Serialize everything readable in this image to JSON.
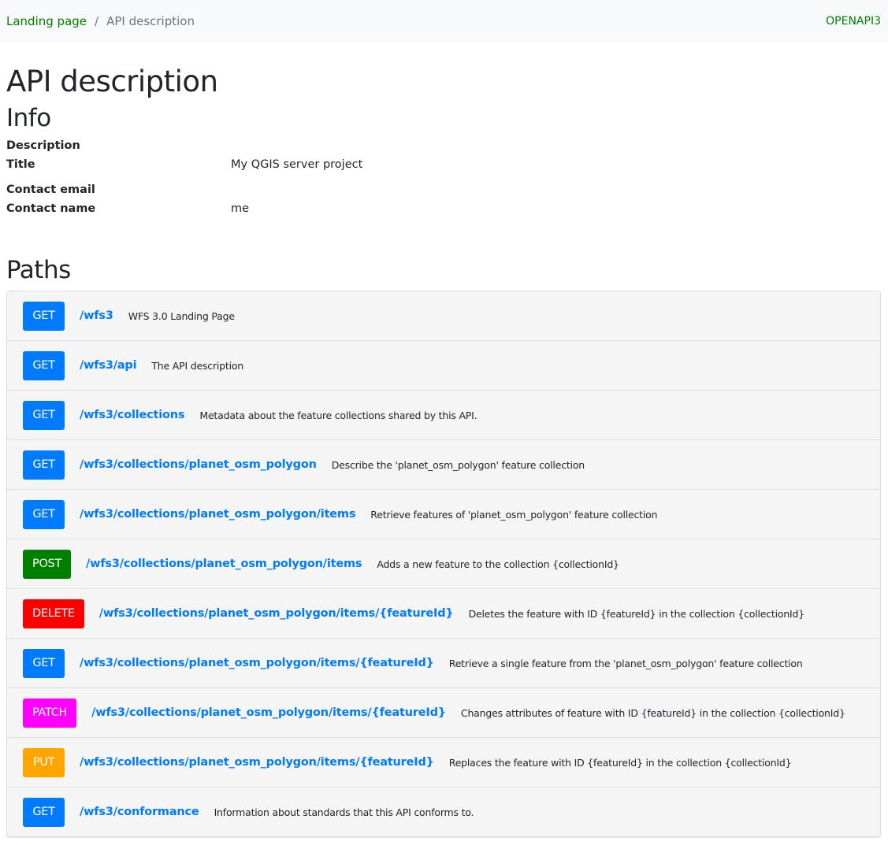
{
  "breadcrumb": {
    "items": [
      {
        "label": "Landing page",
        "link": true
      },
      {
        "label": "API description",
        "link": false
      }
    ],
    "separator": "/"
  },
  "topbar": {
    "format_link": "OPENAPI3"
  },
  "page": {
    "title": "API description"
  },
  "info": {
    "heading": "Info",
    "rows": [
      {
        "key": "Description",
        "value": ""
      },
      {
        "key": "Title",
        "value": "My QGIS server project"
      },
      {
        "key": "Contact email",
        "value": ""
      },
      {
        "key": "Contact name",
        "value": "me"
      }
    ]
  },
  "paths": {
    "heading": "Paths",
    "method_colors": {
      "GET": "#007bff",
      "POST": "#008000",
      "DELETE": "#ff0000",
      "PATCH": "#ff00ff",
      "PUT": "#ffa500"
    },
    "items": [
      {
        "method": "GET",
        "path": "/wfs3",
        "summary": "WFS 3.0 Landing Page"
      },
      {
        "method": "GET",
        "path": "/wfs3/api",
        "summary": "The API description"
      },
      {
        "method": "GET",
        "path": "/wfs3/collections",
        "summary": "Metadata about the feature collections shared by this API."
      },
      {
        "method": "GET",
        "path": "/wfs3/collections/planet_osm_polygon",
        "summary": "Describe the 'planet_osm_polygon' feature collection"
      },
      {
        "method": "GET",
        "path": "/wfs3/collections/planet_osm_polygon/items",
        "summary": "Retrieve features of 'planet_osm_polygon' feature collection"
      },
      {
        "method": "POST",
        "path": "/wfs3/collections/planet_osm_polygon/items",
        "summary": "Adds a new feature to the collection {collectionId}"
      },
      {
        "method": "DELETE",
        "path": "/wfs3/collections/planet_osm_polygon/items/{featureId}",
        "summary": "Deletes the feature with ID {featureId} in the collection {collectionId}"
      },
      {
        "method": "GET",
        "path": "/wfs3/collections/planet_osm_polygon/items/{featureId}",
        "summary": "Retrieve a single feature from the 'planet_osm_polygon' feature collection"
      },
      {
        "method": "PATCH",
        "path": "/wfs3/collections/planet_osm_polygon/items/{featureId}",
        "summary": "Changes attributes of feature with ID {featureId} in the collection {collectionId}"
      },
      {
        "method": "PUT",
        "path": "/wfs3/collections/planet_osm_polygon/items/{featureId}",
        "summary": "Replaces the feature with ID {featureId} in the collection {collectionId}"
      },
      {
        "method": "GET",
        "path": "/wfs3/conformance",
        "summary": "Information about standards that this API conforms to."
      }
    ]
  }
}
